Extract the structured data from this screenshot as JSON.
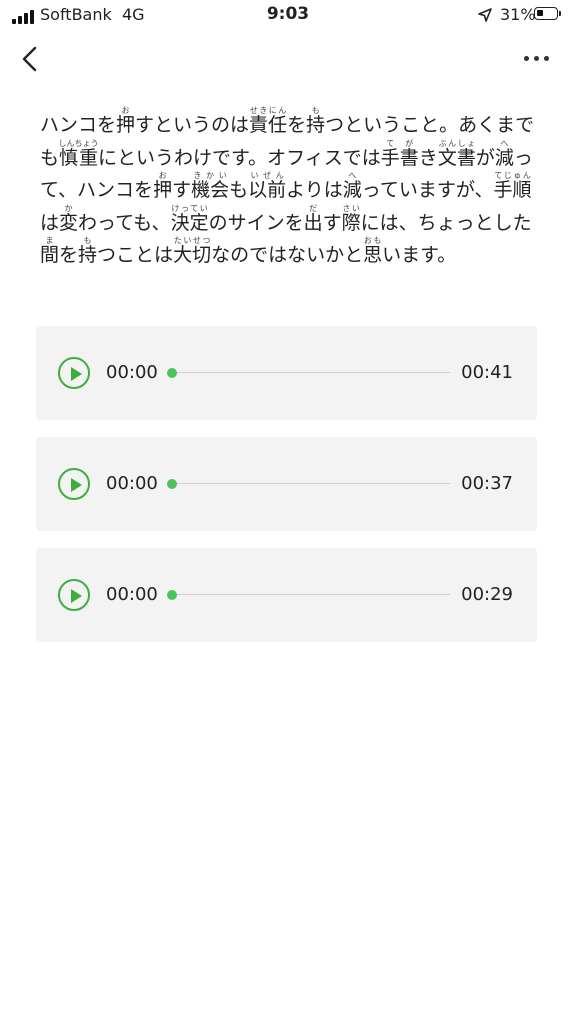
{
  "status_bar": {
    "carrier": "SoftBank",
    "network": "4G",
    "time": "9:03",
    "battery_percent": "31%",
    "battery_level": 0.31,
    "icons": [
      "signal-icon",
      "location-arrow-icon",
      "battery-icon"
    ]
  },
  "nav": {
    "back_icon": "chevron-left-icon",
    "more_icon": "ellipsis-icon"
  },
  "passage": {
    "segments": [
      {
        "t": "ハンコを"
      },
      {
        "t": "押",
        "r": "お"
      },
      {
        "t": "すというのは"
      },
      {
        "t": "責任",
        "r": "せきにん"
      },
      {
        "t": "を"
      },
      {
        "t": "持",
        "r": "も"
      },
      {
        "t": "つということ。あくまでも"
      },
      {
        "t": "慎重",
        "r": "しんちょう"
      },
      {
        "t": "にというわけです。オフィスでは"
      },
      {
        "t": "手",
        "r": "て"
      },
      {
        "t": "書",
        "r": "が"
      },
      {
        "t": "き"
      },
      {
        "t": "文書",
        "r": "ぶんしょ"
      },
      {
        "t": "が"
      },
      {
        "t": "減",
        "r": "へ"
      },
      {
        "t": "って、ハンコを"
      },
      {
        "t": "押",
        "r": "お"
      },
      {
        "t": "す"
      },
      {
        "t": "機会",
        "r": "きかい"
      },
      {
        "t": "も"
      },
      {
        "t": "以前",
        "r": "いぜん"
      },
      {
        "t": "よりは"
      },
      {
        "t": "減",
        "r": "へ"
      },
      {
        "t": "っていますが、"
      },
      {
        "t": "手順",
        "r": "てじゅん"
      },
      {
        "t": "は"
      },
      {
        "t": "変",
        "r": "か"
      },
      {
        "t": "わっても、"
      },
      {
        "t": "決定",
        "r": "けってい"
      },
      {
        "t": "のサインを"
      },
      {
        "t": "出",
        "r": "だ"
      },
      {
        "t": "す"
      },
      {
        "t": "際",
        "r": "さい"
      },
      {
        "t": "には、ちょっとした"
      },
      {
        "t": "間",
        "r": "ま"
      },
      {
        "t": "を"
      },
      {
        "t": "持",
        "r": "も"
      },
      {
        "t": "つことは"
      },
      {
        "t": "大切",
        "r": "たいせつ"
      },
      {
        "t": "なのではないかと"
      },
      {
        "t": "思",
        "r": "おも"
      },
      {
        "t": "います。"
      }
    ]
  },
  "audio_players": [
    {
      "current": "00:00",
      "duration": "00:41",
      "progress": 0
    },
    {
      "current": "00:00",
      "duration": "00:37",
      "progress": 0
    },
    {
      "current": "00:00",
      "duration": "00:29",
      "progress": 0
    }
  ],
  "colors": {
    "accent_green": "#3dae3d",
    "thumb_green": "#4cc45e",
    "card_bg": "#f3f3f3"
  }
}
